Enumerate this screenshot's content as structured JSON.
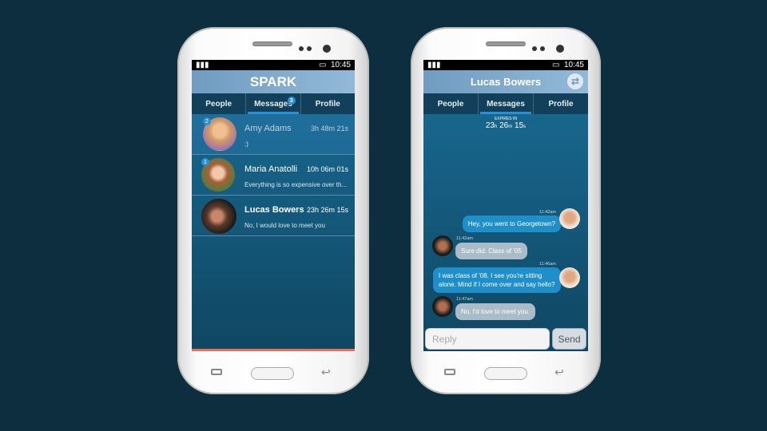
{
  "status": {
    "time": "10:45"
  },
  "list_screen": {
    "title": "SPARK",
    "tabs": [
      {
        "label": "People"
      },
      {
        "label": "Messages",
        "badge": "3"
      },
      {
        "label": "Profile"
      }
    ],
    "conversations": [
      {
        "name": "Amy Adams",
        "badge": "2",
        "h": "3",
        "m": "48",
        "s": "21",
        "preview": ":)"
      },
      {
        "name": "Maria Anatolli",
        "badge": "1",
        "h": "10",
        "m": "06",
        "s": "01",
        "preview": "Everything is so expensive over th..."
      },
      {
        "name": "Lucas Bowers",
        "h": "23",
        "m": "26",
        "s": "15",
        "preview": "No, I would love to meet you"
      }
    ]
  },
  "chat_screen": {
    "title": "Lucas Bowers",
    "tabs": [
      {
        "label": "People"
      },
      {
        "label": "Messages"
      },
      {
        "label": "Profile"
      }
    ],
    "expires_label": "EXPIRES IN",
    "expires": {
      "h": "23",
      "m": "26",
      "s": "15"
    },
    "units": {
      "h": "h",
      "m": "m",
      "s": "s"
    },
    "messages": [
      {
        "dir": "out",
        "time": "11:42am",
        "text": "Hey, you went to Georgetown?"
      },
      {
        "dir": "in",
        "time": "11:42am",
        "text": "Sure did. Class of '05"
      },
      {
        "dir": "out",
        "time": "11:46am",
        "text": "I was class of '08. I see you're sitting alone. Mind if I come over and say hello?"
      },
      {
        "dir": "in",
        "time": "11:47am",
        "text": "No, I'd love to meet you."
      }
    ],
    "reply_placeholder": "Reply",
    "send_label": "Send"
  }
}
